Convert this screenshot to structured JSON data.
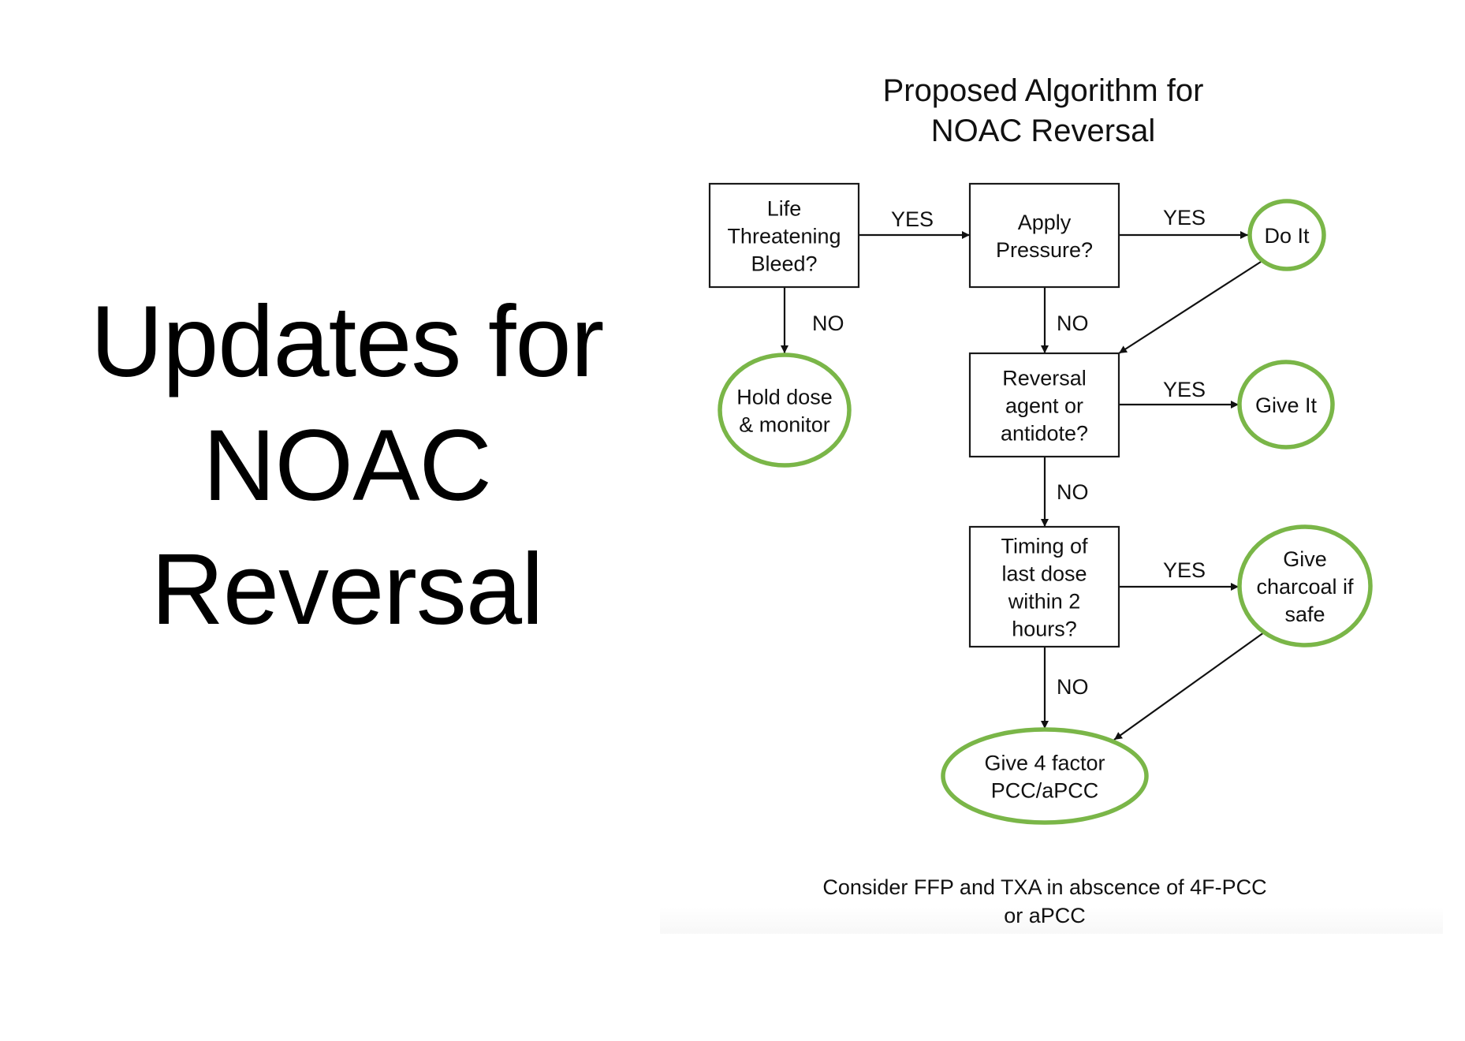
{
  "slide": {
    "title_lines": [
      "Updates for",
      "NOAC",
      "Reversal"
    ]
  },
  "diagram": {
    "title_lines": [
      "Proposed Algorithm for",
      "NOAC Reversal"
    ],
    "colors": {
      "terminal_stroke": "#7ab648",
      "decision_stroke": "#1a1a1a",
      "arrow": "#111111",
      "text": "#111111"
    },
    "nodes": [
      {
        "id": "life-threatening-bleed",
        "shape": "decision",
        "lines": [
          "Life",
          "Threatening",
          "Bleed?"
        ]
      },
      {
        "id": "apply-pressure",
        "shape": "decision",
        "lines": [
          "Apply",
          "Pressure?"
        ]
      },
      {
        "id": "do-it",
        "shape": "terminal",
        "lines": [
          "Do It"
        ]
      },
      {
        "id": "hold-dose",
        "shape": "terminal",
        "lines": [
          "Hold dose",
          "& monitor"
        ]
      },
      {
        "id": "reversal-agent",
        "shape": "decision",
        "lines": [
          "Reversal",
          "agent or",
          "antidote?"
        ]
      },
      {
        "id": "give-it",
        "shape": "terminal",
        "lines": [
          "Give It"
        ]
      },
      {
        "id": "timing-last-dose",
        "shape": "decision",
        "lines": [
          "Timing of",
          "last dose",
          "within 2",
          "hours?"
        ]
      },
      {
        "id": "give-charcoal",
        "shape": "terminal",
        "lines": [
          "Give",
          "charcoal if",
          "safe"
        ]
      },
      {
        "id": "give-4-factor-pcc",
        "shape": "terminal",
        "lines": [
          "Give 4 factor",
          "PCC/aPCC"
        ]
      }
    ],
    "edges": [
      {
        "from": "life-threatening-bleed",
        "to": "apply-pressure",
        "label": "YES"
      },
      {
        "from": "life-threatening-bleed",
        "to": "hold-dose",
        "label": "NO"
      },
      {
        "from": "apply-pressure",
        "to": "do-it",
        "label": "YES"
      },
      {
        "from": "apply-pressure",
        "to": "reversal-agent",
        "label": "NO"
      },
      {
        "from": "do-it",
        "to": "reversal-agent",
        "label": ""
      },
      {
        "from": "reversal-agent",
        "to": "give-it",
        "label": "YES"
      },
      {
        "from": "reversal-agent",
        "to": "timing-last-dose",
        "label": "NO"
      },
      {
        "from": "timing-last-dose",
        "to": "give-charcoal",
        "label": "YES"
      },
      {
        "from": "timing-last-dose",
        "to": "give-4-factor-pcc",
        "label": "NO"
      },
      {
        "from": "give-charcoal",
        "to": "give-4-factor-pcc",
        "label": ""
      }
    ],
    "footnote_lines": [
      "Consider FFP and TXA in abscence of 4F-PCC",
      "or aPCC"
    ]
  }
}
